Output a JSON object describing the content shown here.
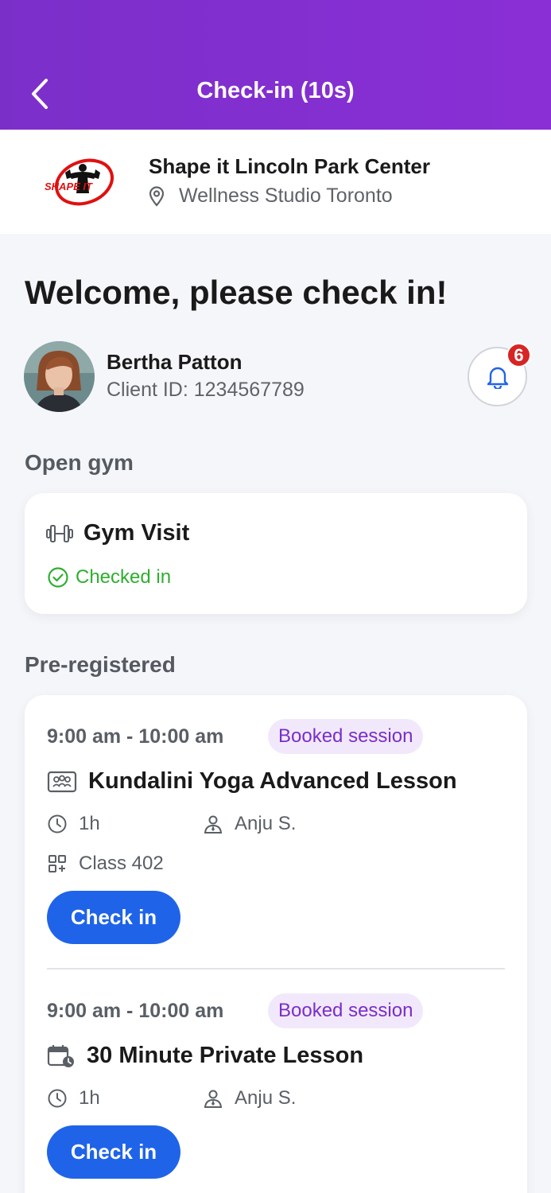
{
  "header": {
    "title": "Check-in (10s)"
  },
  "center": {
    "name": "Shape it Lincoln Park Center",
    "location": "Wellness Studio Toronto",
    "logo_text": "SHAPE IT"
  },
  "welcome": "Welcome, please check in!",
  "client": {
    "name": "Bertha Patton",
    "id_label": "Client ID: 1234567789"
  },
  "notifications": {
    "count": "6"
  },
  "open_gym": {
    "label": "Open gym",
    "title": "Gym Visit",
    "status": "Checked in"
  },
  "pre_registered": {
    "label": "Pre-registered",
    "sessions": [
      {
        "time": "9:00 am - 10:00 am",
        "badge": "Booked session",
        "title": "Kundalini Yoga Advanced Lesson",
        "duration": "1h",
        "instructor": "Anju S.",
        "room": "Class 402",
        "button": "Check in"
      },
      {
        "time": "9:00 am - 10:00 am",
        "badge": "Booked session",
        "title": "30 Minute Private Lesson",
        "duration": "1h",
        "instructor": "Anju S.",
        "button": "Check in"
      }
    ]
  },
  "colors": {
    "header": "#8a2fd6",
    "primary": "#1f64e8",
    "success": "#2fae2f",
    "badge_bg": "#f1e9fb",
    "badge_text": "#7a2ec8",
    "alert": "#d82424"
  }
}
